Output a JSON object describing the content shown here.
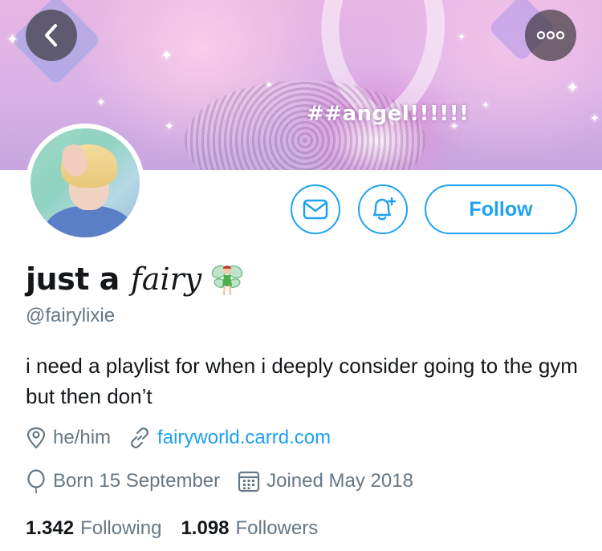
{
  "banner": {
    "text": "##angel!!!!!!"
  },
  "nav": {
    "back_icon": "chevron-left-icon",
    "more_icon": "more-dots-icon"
  },
  "actions": {
    "message_icon": "envelope-icon",
    "notify_icon": "bell-plus-icon",
    "follow_label": "Follow"
  },
  "profile": {
    "name_main": "just a",
    "name_fancy": "fairy",
    "handle": "@fairylixie",
    "bio": "i need a playlist for when i deeply consider going to the gym but then don’t",
    "pronouns": "he/him",
    "website": "fairyworld.carrd.com",
    "birthday": "Born 15 September",
    "joined": "Joined May 2018"
  },
  "stats": {
    "following_count": "1.342",
    "following_label": "Following",
    "followers_count": "1.098",
    "followers_label": "Followers"
  },
  "colors": {
    "accent": "#1da1f2",
    "muted": "#657786",
    "text": "#14171a"
  }
}
